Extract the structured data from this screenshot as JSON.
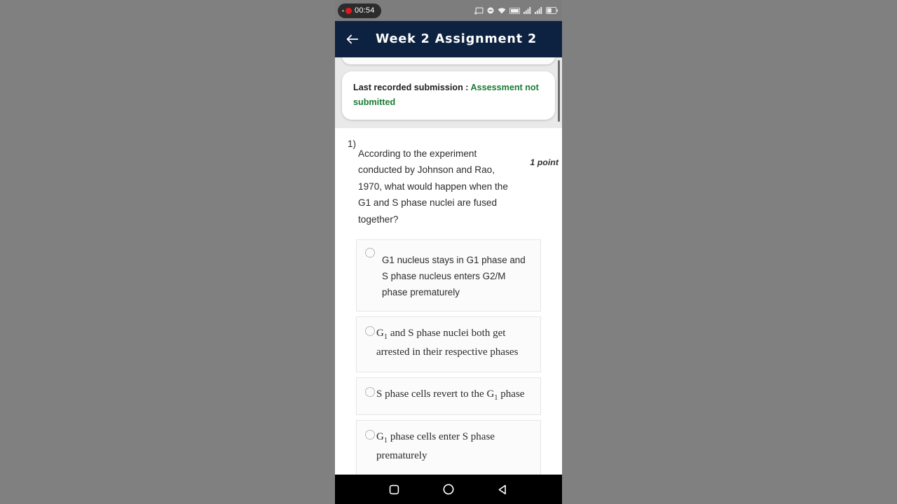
{
  "status_bar": {
    "recording_timer": "00:54",
    "recording_icon": "record-dot-icon",
    "icons": [
      "cast-icon",
      "dnd-icon",
      "wifi-icon",
      "mobile-data-icon",
      "signal-bars-icon",
      "signal-bars-icon",
      "battery-icon"
    ],
    "battery_level": "46"
  },
  "app_bar": {
    "back_icon": "back-arrow-icon",
    "title": "Week 2 Assignment 2"
  },
  "submission_card": {
    "label": "Last recorded submission : ",
    "status": "Assessment not submitted",
    "status_color": "#1a7a34"
  },
  "question": {
    "number": "1)",
    "text": "According to the experiment conducted by Johnson and Rao, 1970, what would happen when the G1 and S phase nuclei are fused together?",
    "points": "1 point"
  },
  "options": [
    {
      "id": "option-a",
      "style": "sans",
      "text": "G1 nucleus stays in G1 phase and S phase nucleus enters G2/M phase prematurely",
      "selected": false
    },
    {
      "id": "option-b",
      "style": "serif",
      "text_pre": "G",
      "text_sub": "1",
      "text_post": " and S phase nuclei both get arrested in their respective phases",
      "selected": false
    },
    {
      "id": "option-c",
      "style": "serif",
      "text_pre": "S phase cells revert to the G",
      "text_sub": "1",
      "text_post": " phase",
      "selected": false
    },
    {
      "id": "option-d",
      "style": "serif",
      "text_pre": "G",
      "text_sub": "1",
      "text_post": " phase cells enter S phase prematurely",
      "selected": false
    }
  ],
  "nav_bar": {
    "recents_icon": "square-recents-icon",
    "home_icon": "circle-home-icon",
    "back_icon": "triangle-back-icon"
  },
  "colors": {
    "app_bar": "#0d2240",
    "status_bar": "#7d7d7d",
    "page_bg": "#e9e9e9",
    "letterbox": "#808080",
    "success": "#1a7a34"
  }
}
